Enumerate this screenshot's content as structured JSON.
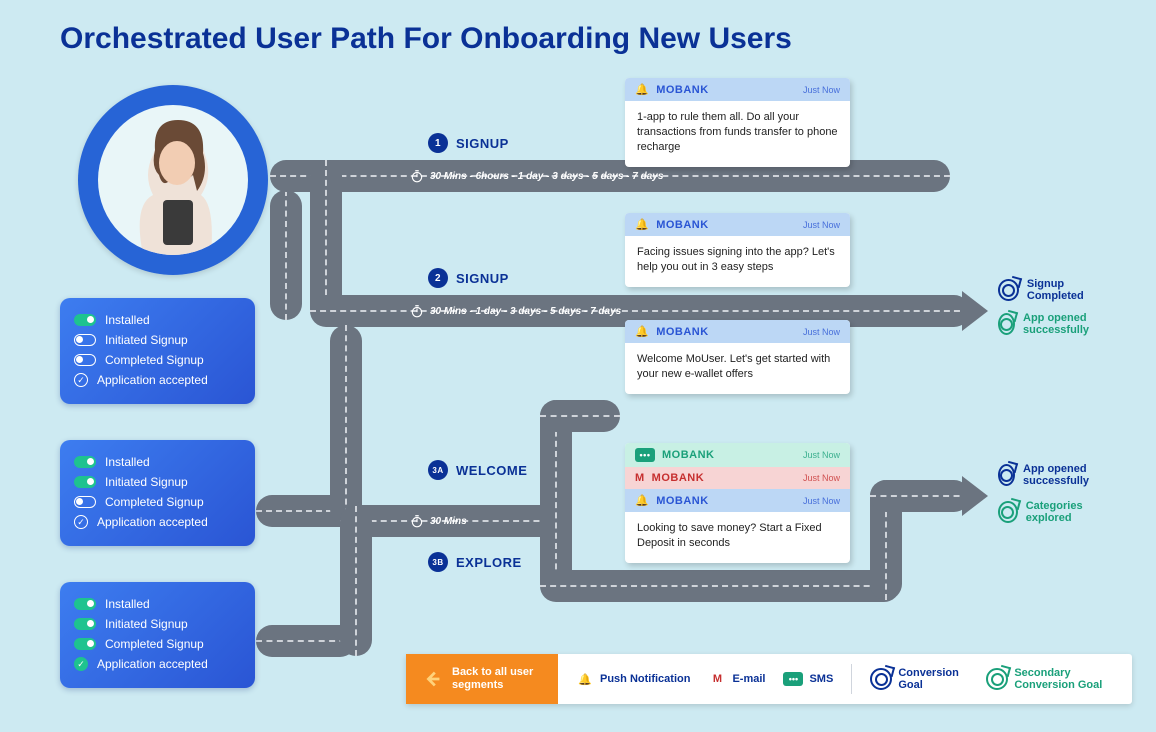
{
  "title": "Orchestrated User Path For Onboarding New Users",
  "segments": [
    {
      "rows": [
        {
          "t": "on",
          "label": "Installed"
        },
        {
          "t": "off",
          "label": "Initiated Signup"
        },
        {
          "t": "off",
          "label": "Completed Signup"
        },
        {
          "t": "chk",
          "on": false,
          "label": "Application accepted"
        }
      ]
    },
    {
      "rows": [
        {
          "t": "on",
          "label": "Installed"
        },
        {
          "t": "on",
          "label": "Initiated Signup"
        },
        {
          "t": "off",
          "label": "Completed Signup"
        },
        {
          "t": "chk",
          "on": false,
          "label": "Application accepted"
        }
      ]
    },
    {
      "rows": [
        {
          "t": "on",
          "label": "Installed"
        },
        {
          "t": "on",
          "label": "Initiated Signup"
        },
        {
          "t": "on",
          "label": "Completed Signup"
        },
        {
          "t": "chk",
          "on": true,
          "label": "Application accepted"
        }
      ]
    }
  ],
  "steps": {
    "s1": {
      "num": "1",
      "label": "SIGNUP",
      "timing": "30 Mins - 6hours - 1 day - 3 days - 5 days - 7 days"
    },
    "s2": {
      "num": "2",
      "label": "SIGNUP",
      "timing": "30 Mins - 1 day - 3 days - 5 days - 7 days"
    },
    "s3a": {
      "num": "3A",
      "label": "WELCOME",
      "timing": "30 Mins"
    },
    "s3b": {
      "num": "3B",
      "label": "EXPLORE"
    }
  },
  "cards": {
    "c1": {
      "brand": "MOBANK",
      "time": "Just Now",
      "body": "1-app to rule them all. Do all your transactions from funds transfer to phone recharge"
    },
    "c2": {
      "brand": "MOBANK",
      "time": "Just Now",
      "body": "Facing issues signing into the app? Let's help you out in 3 easy steps"
    },
    "c3": {
      "brand": "MOBANK",
      "time": "Just Now",
      "body": "Welcome MoUser. Let's get started with your new e-wallet offers"
    },
    "c4": {
      "sms": {
        "brand": "MOBANK",
        "time": "Just Now"
      },
      "mail": {
        "brand": "MOBANK",
        "time": "Just Now"
      },
      "push": {
        "brand": "MOBANK",
        "time": "Just Now"
      },
      "body": "Looking to save money? Start a Fixed Deposit in seconds"
    }
  },
  "goals": {
    "g1a": "Signup Completed",
    "g1b": "App opened successfully",
    "g2a": "App opened successfully",
    "g2b": "Categories explored"
  },
  "legend": {
    "back": "Back to all user segments",
    "push": "Push Notification",
    "email": "E-mail",
    "sms": "SMS",
    "conv": "Conversion Goal",
    "sec": "Secondary Conversion Goal"
  }
}
